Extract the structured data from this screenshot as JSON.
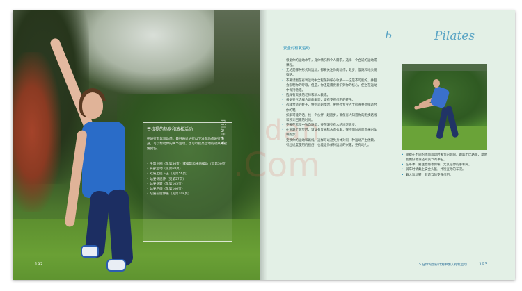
{
  "left_page": {
    "overlay_title": "普拉提的热身和放松活动",
    "overlay_intro": "在进行有氧运动前，最好通过进行以下准备动作进行热身，可以帮助你的关节运动，也可以提高运动的效果并避免受伤。",
    "overlay_items": [
      "手臂划圈（见第56页）或摆臂和横向摆动（见第50页）",
      "肩部运动（见第68页）",
      "双肩上提下压（见第56页）",
      "站姿侧屈伸（见第57页）",
      "站姿侧转（见第105页）",
      "站姿后倾（见第106页）",
      "站姿前屈伸展（见第108页）"
    ],
    "overlay_vertical": "Pilates",
    "page_number": "192"
  },
  "right_page": {
    "brand_title": "Pilates",
    "brand_mark": "Ь",
    "section_title": "安全的有氧运动",
    "bullets": [
      "根据你的运动水平，身体情况和个人需求，选择一个合适的运动或课程。",
      "无论是哪种形式的运动，都要关注你的动作，数步，慢跑和地头观察路。",
      "不要试图在有氧运动中全程保持核心收紧——这是不可能的，并且会限制你的呼吸。但是，你还是需要意识到你的核心，使之在运动中保持稳定。",
      "选择有资质的老师和私人教练。",
      "根据天气选择合适的服装，穿有支撑作用的鞋子。",
      "选择合适的鞋子，特别是跑步时，要经过专业人士检查并选择适合你的鞋。",
      "如果可能的话，找一个伙伴一起跑步，确保有人知道你的跑步路线和预计回家的时间。",
      "不要在黑暗中独自跑步，要在明亮有人的地方跑步。",
      "在道路上跑步时，请穿有反光标志的衣服，保持面向迎面而来的车辆跑步。",
      "变换你的运动和路线。这样可以避免身体对同一种运动产生依赖，引起过度使用的损伤，也能让你保持运动的兴趣，更有动力。"
    ],
    "bullets_right": [
      "观察在不同的地面运动时关节的影响。跟踪土比路面，草地能更好地减轻对关节的冲击。",
      "在冬季，要注意防寒保暖，尤其是你的手和脚。",
      "骑车时请戴上安全头盔，并检查你的车况。",
      "戴入运动鞋，有适当的支撑作用。"
    ],
    "footer_text": "5 在你的塑形计划中加入有氧运动",
    "page_number": "193"
  }
}
